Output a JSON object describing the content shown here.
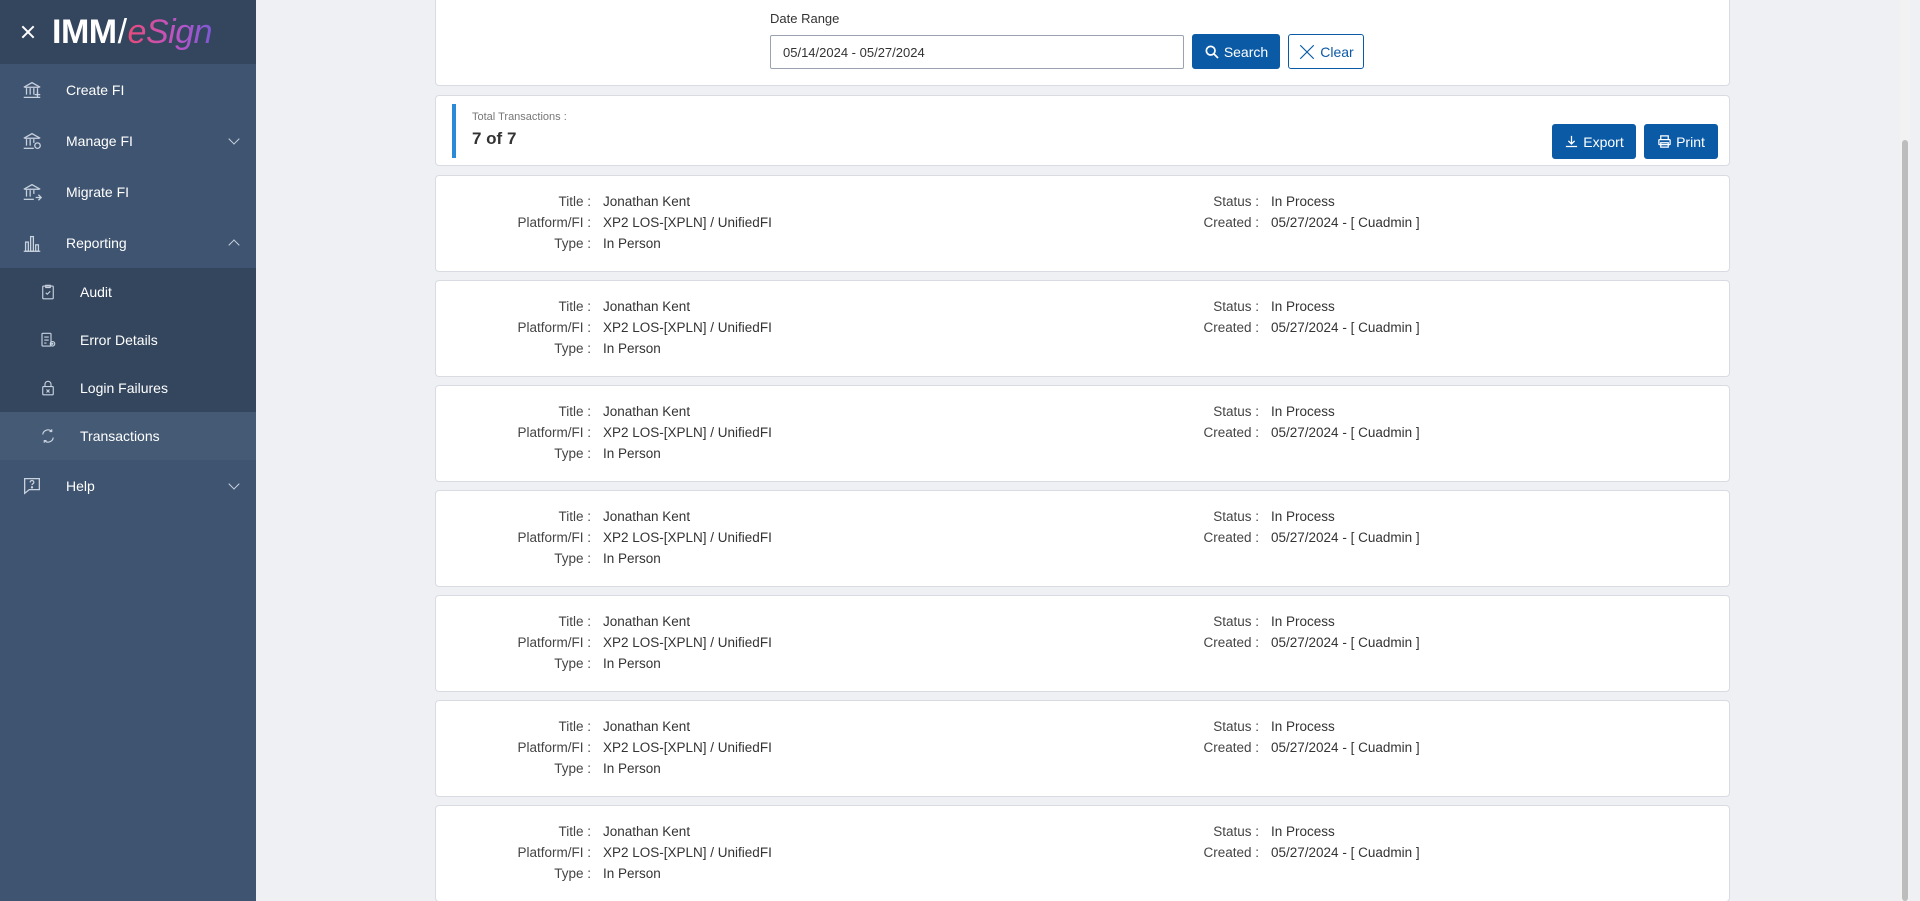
{
  "sidebar": {
    "logo_prefix": "IMM",
    "logo_slash": "/",
    "logo_suffix": "eSign",
    "items": [
      {
        "label": "Create FI"
      },
      {
        "label": "Manage FI"
      },
      {
        "label": "Migrate FI"
      },
      {
        "label": "Reporting"
      },
      {
        "label": "Help"
      }
    ],
    "reporting_sub": [
      {
        "label": "Audit"
      },
      {
        "label": "Error Details"
      },
      {
        "label": "Login Failures"
      },
      {
        "label": "Transactions"
      }
    ]
  },
  "filter": {
    "date_label": "Date Range",
    "date_value": "05/14/2024 - 05/27/2024",
    "search_label": "Search",
    "clear_label": "Clear"
  },
  "summary": {
    "label": "Total Transactions :",
    "count": "7 of 7",
    "export_label": "Export",
    "print_label": "Print"
  },
  "field_labels": {
    "title": "Title :",
    "platform": "Platform/FI :",
    "type": "Type :",
    "status": "Status :",
    "created": "Created :"
  },
  "transactions": [
    {
      "title": "Jonathan Kent",
      "platform": "XP2 LOS-[XPLN] / UnifiedFI",
      "type": "In Person",
      "status": "In Process",
      "created": "05/27/2024 - [ Cuadmin ]"
    },
    {
      "title": "Jonathan Kent",
      "platform": "XP2 LOS-[XPLN] / UnifiedFI",
      "type": "In Person",
      "status": "In Process",
      "created": "05/27/2024 - [ Cuadmin ]"
    },
    {
      "title": "Jonathan Kent",
      "platform": "XP2 LOS-[XPLN] / UnifiedFI",
      "type": "In Person",
      "status": "In Process",
      "created": "05/27/2024 - [ Cuadmin ]"
    },
    {
      "title": "Jonathan Kent",
      "platform": "XP2 LOS-[XPLN] / UnifiedFI",
      "type": "In Person",
      "status": "In Process",
      "created": "05/27/2024 - [ Cuadmin ]"
    },
    {
      "title": "Jonathan Kent",
      "platform": "XP2 LOS-[XPLN] / UnifiedFI",
      "type": "In Person",
      "status": "In Process",
      "created": "05/27/2024 - [ Cuadmin ]"
    },
    {
      "title": "Jonathan Kent",
      "platform": "XP2 LOS-[XPLN] / UnifiedFI",
      "type": "In Person",
      "status": "In Process",
      "created": "05/27/2024 - [ Cuadmin ]"
    },
    {
      "title": "Jonathan Kent",
      "platform": "XP2 LOS-[XPLN] / UnifiedFI",
      "type": "In Person",
      "status": "In Process",
      "created": "05/27/2024 - [ Cuadmin ]"
    }
  ],
  "colors": {
    "sidebar_bg": "#3f5470",
    "sidebar_header_bg": "#34465e",
    "primary": "#0b5aa6",
    "accent_bar": "#2b8ad8"
  }
}
